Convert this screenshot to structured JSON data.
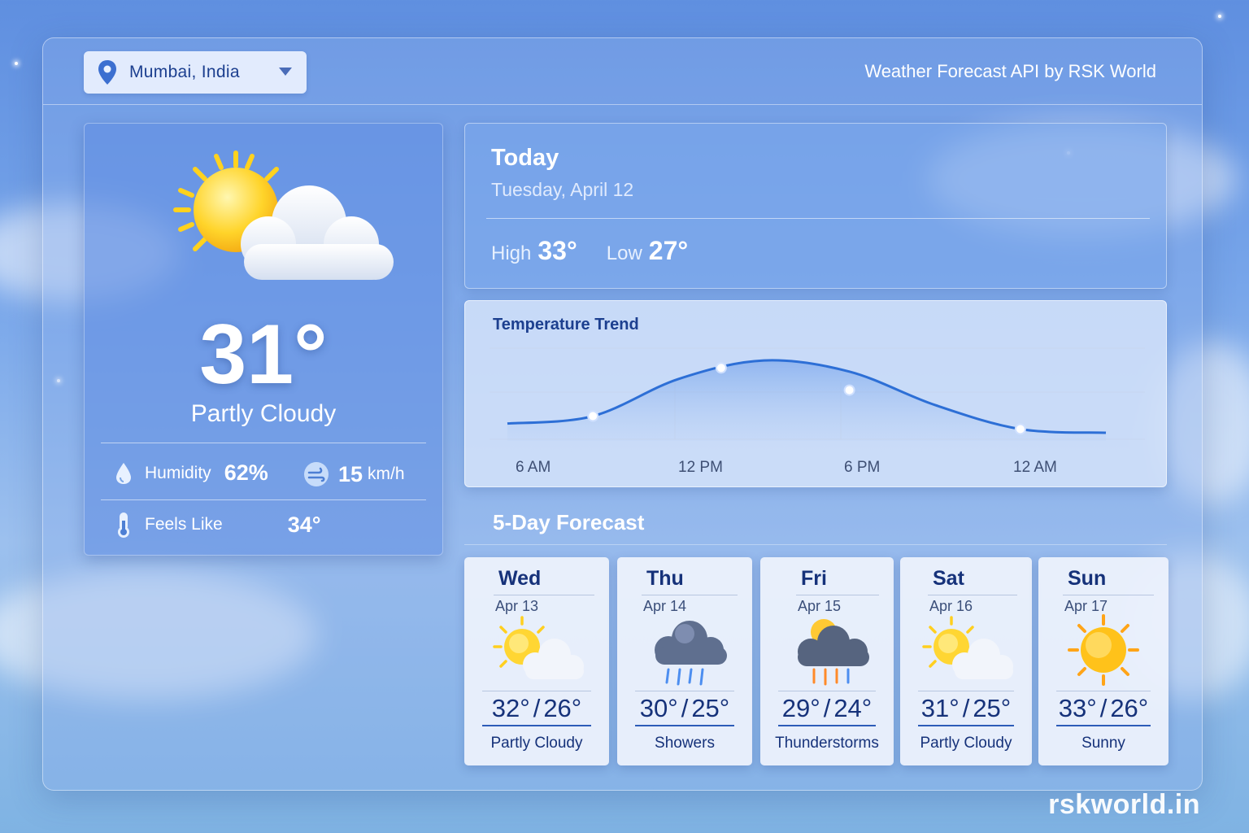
{
  "header": {
    "location": "Mumbai, India",
    "brand": "Weather Forecast API by RSK World"
  },
  "current": {
    "temperature": "31°",
    "condition": "Partly Cloudy",
    "humidity_label": "Humidity",
    "humidity_value": "62%",
    "wind_value": "15",
    "wind_unit": "km/h",
    "feels_like_label": "Feels Like",
    "feels_like_value": "34°",
    "icon": "partly-cloudy-icon"
  },
  "today": {
    "title": "Today",
    "date": "Tuesday, April 12",
    "high_label": "High",
    "high_value": "33°",
    "low_label": "Low",
    "low_value": "27°"
  },
  "chart_data": {
    "type": "line",
    "title": "Temperature Trend",
    "x_ticks": [
      "6 AM",
      "12 PM",
      "6 PM",
      "12 AM"
    ],
    "points": [
      {
        "x": "6 AM",
        "y": 28.2
      },
      {
        "x": "9 AM",
        "y": 28.6
      },
      {
        "x": "12 PM",
        "y": 30.6
      },
      {
        "x": "3 PM",
        "y": 31.6
      },
      {
        "x": "6 PM",
        "y": 31.0
      },
      {
        "x": "9 PM",
        "y": 29.2
      },
      {
        "x": "12 AM",
        "y": 27.9
      },
      {
        "x": "3 AM",
        "y": 27.7
      }
    ],
    "markers": [
      {
        "x": "9 AM",
        "y": 28.6
      },
      {
        "x": "1:30 PM",
        "y": 31.2
      },
      {
        "x": "6 PM",
        "y": 30.0
      },
      {
        "x": "12 AM",
        "y": 27.9
      }
    ],
    "line_color": "#2d6fd6",
    "grid": true
  },
  "forecast": {
    "title": "5-Day Forecast",
    "days": [
      {
        "day": "Wed",
        "date": "Apr 13",
        "high": "32°",
        "low": "26°",
        "condition": "Partly Cloudy",
        "icon": "partly-cloudy-icon"
      },
      {
        "day": "Thu",
        "date": "Apr 14",
        "high": "30°",
        "low": "25°",
        "condition": "Showers",
        "icon": "rain-cloud-icon"
      },
      {
        "day": "Fri",
        "date": "Apr 15",
        "high": "29°",
        "low": "24°",
        "condition": "Thunderstorms",
        "icon": "thunderstorm-icon"
      },
      {
        "day": "Sat",
        "date": "Apr 16",
        "high": "31°",
        "low": "25°",
        "condition": "Partly Cloudy",
        "icon": "partly-cloudy-icon"
      },
      {
        "day": "Sun",
        "date": "Apr 17",
        "high": "33°",
        "low": "26°",
        "condition": "Sunny",
        "icon": "sun-icon"
      }
    ]
  },
  "watermark": "rskworld.in"
}
